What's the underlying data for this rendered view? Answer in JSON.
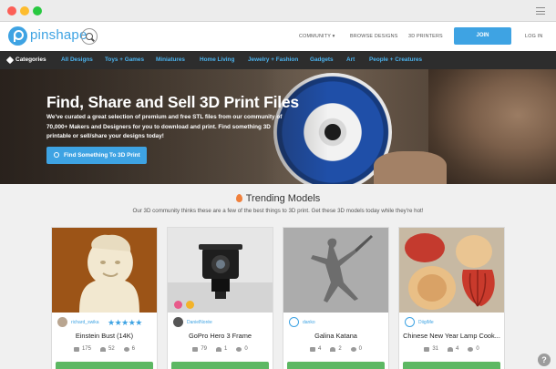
{
  "header": {
    "logo_text": "pinshape",
    "nav": {
      "community": "COMMUNITY ▾",
      "browse": "BROWSE DESIGNS",
      "printers": "3D PRINTERS",
      "join": "JOIN",
      "login": "LOG IN"
    }
  },
  "categories": {
    "label": "Categories",
    "items": [
      "All Designs",
      "Toys + Games",
      "Miniatures",
      "Home Living",
      "Jewelry + Fashion",
      "Gadgets",
      "Art",
      "People + Creatures"
    ]
  },
  "hero": {
    "title": "Find, Share and Sell 3D Print Files",
    "description": "We've curated a great selection of premium and free STL files from our community of 70,000+ Makers and Designers for you to download and print. Find something 3D printable or sell/share your designs today!",
    "cta": "Find Something To 3D Print"
  },
  "trending": {
    "title": "Trending Models",
    "subtitle": "Our 3D community thinks these are a few of the best things to 3D print. Get these 3D models today while they're hot!"
  },
  "cards": [
    {
      "user": "richard_swika",
      "stars": "★★★★★",
      "title": "Einstein Bust (14K)",
      "views": "175",
      "likes": "52",
      "comments": "6"
    },
    {
      "user": "DanielNorée",
      "stars": "",
      "title": "GoPro Hero 3 Frame",
      "views": "79",
      "likes": "1",
      "comments": "0"
    },
    {
      "user": "danko",
      "stars": "",
      "title": "Galina Katana",
      "views": "4",
      "likes": "2",
      "comments": "0"
    },
    {
      "user": "DiigiMe",
      "stars": "",
      "title": "Chinese New Year Lamp Cook...",
      "views": "31",
      "likes": "4",
      "comments": "0"
    }
  ],
  "help": "?",
  "colors": {
    "brand": "#3ea3e3",
    "download": "#5db863",
    "catbar": "#2d2d2d"
  }
}
